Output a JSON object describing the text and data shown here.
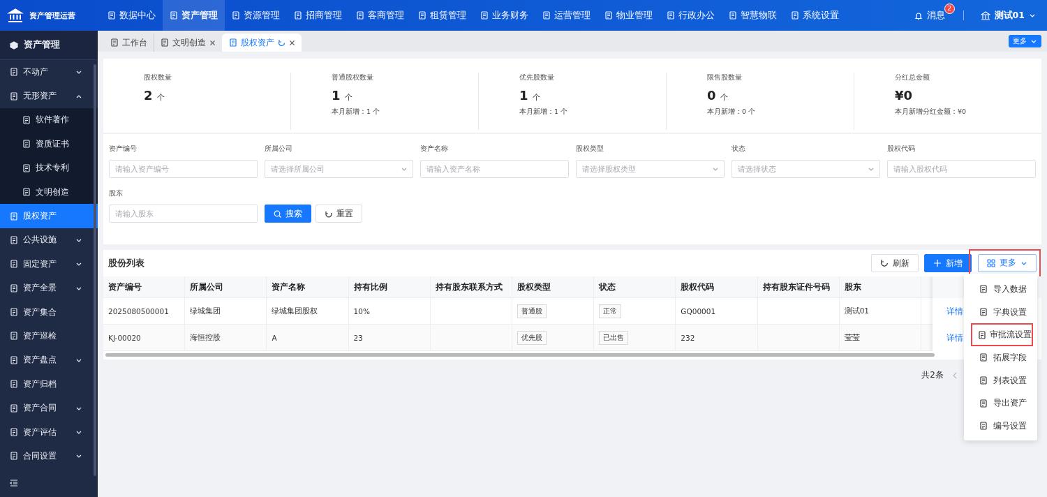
{
  "app": {
    "title": "资产管理运营"
  },
  "top_nav": [
    {
      "label": "数据中心",
      "selected": false
    },
    {
      "label": "资产管理",
      "selected": true
    },
    {
      "label": "资源管理",
      "selected": false
    },
    {
      "label": "招商管理",
      "selected": false
    },
    {
      "label": "客商管理",
      "selected": false
    },
    {
      "label": "租赁管理",
      "selected": false
    },
    {
      "label": "业务财务",
      "selected": false
    },
    {
      "label": "运营管理",
      "selected": false
    },
    {
      "label": "物业管理",
      "selected": false
    },
    {
      "label": "行政办公",
      "selected": false
    },
    {
      "label": "智慧物联",
      "selected": false
    },
    {
      "label": "系统设置",
      "selected": false
    }
  ],
  "top_right": {
    "messages": "消息",
    "badge": "2",
    "user": "测试01"
  },
  "sidebar": {
    "title": "资产管理",
    "items": [
      {
        "label": "不动产",
        "selected": false,
        "expanded": false
      },
      {
        "label": "无形资产",
        "selected": false,
        "expanded": true,
        "children": [
          {
            "label": "软件著作",
            "selected": false
          },
          {
            "label": "资质证书",
            "selected": false
          },
          {
            "label": "技术专利",
            "selected": false
          },
          {
            "label": "文明创造",
            "selected": false
          }
        ]
      },
      {
        "label": "股权资产",
        "selected": true
      },
      {
        "label": "公共设施",
        "selected": false,
        "expanded": false
      },
      {
        "label": "固定资产",
        "selected": false,
        "expanded": false
      },
      {
        "label": "资产全景",
        "selected": false,
        "expanded": false
      },
      {
        "label": "资产集合",
        "selected": false
      },
      {
        "label": "资产巡检",
        "selected": false
      },
      {
        "label": "资产盘点",
        "selected": false,
        "expanded": false
      },
      {
        "label": "资产归档",
        "selected": false
      },
      {
        "label": "资产合同",
        "selected": false,
        "expanded": false
      },
      {
        "label": "资产评估",
        "selected": false,
        "expanded": false
      },
      {
        "label": "合同设置",
        "selected": false,
        "expanded": false
      }
    ]
  },
  "tabs": [
    {
      "label": "工作台",
      "selected": false,
      "closable": false
    },
    {
      "label": "文明创造",
      "selected": false,
      "closable": true
    },
    {
      "label": "股权资产",
      "selected": true,
      "closable": true
    }
  ],
  "tabs_more": "更多",
  "stats": [
    {
      "label": "股权数量",
      "value": "2",
      "unit": "个"
    },
    {
      "label": "普通股权数量",
      "value": "1",
      "unit": "个",
      "sub": "本月新增：1 个"
    },
    {
      "label": "优先股数量",
      "value": "1",
      "unit": "个",
      "sub": "本月新增：1 个"
    },
    {
      "label": "限售股数量",
      "value": "0",
      "unit": "个",
      "sub": "本月新增：0 个"
    },
    {
      "label": "分红总金额",
      "value": "¥0",
      "sub": "本月新增分红金额：¥0"
    }
  ],
  "filters": [
    {
      "label": "资产编号",
      "placeholder": "请输入资产编号",
      "kind": "input"
    },
    {
      "label": "所属公司",
      "placeholder": "请选择所属公司",
      "kind": "select"
    },
    {
      "label": "资产名称",
      "placeholder": "请输入资产名称",
      "kind": "input"
    },
    {
      "label": "股权类型",
      "placeholder": "请选择股权类型",
      "kind": "select"
    },
    {
      "label": "状态",
      "placeholder": "请选择状态",
      "kind": "select"
    },
    {
      "label": "股权代码",
      "placeholder": "请输入股权代码",
      "kind": "input"
    },
    {
      "label": "股东",
      "placeholder": "请输入股东",
      "kind": "input"
    }
  ],
  "filter_buttons": [
    {
      "label": "搜索",
      "kind": "primary"
    },
    {
      "label": "重置",
      "kind": "default"
    }
  ],
  "table": {
    "title": "股份列表",
    "toolbar": [
      {
        "label": "刷新",
        "kind": "refresh",
        "highlighted": false
      },
      {
        "label": "新增",
        "kind": "add",
        "highlighted": false
      },
      {
        "label": "更多",
        "kind": "more",
        "highlighted": true
      }
    ],
    "columns": [
      {
        "label": "资产编号"
      },
      {
        "label": "所属公司"
      },
      {
        "label": "资产名称"
      },
      {
        "label": "持有比例"
      },
      {
        "label": "持有股东联系方式"
      },
      {
        "label": "股权类型",
        "kind": "tag"
      },
      {
        "label": "状态",
        "kind": "tag"
      },
      {
        "label": "股权代码"
      },
      {
        "label": "持有股东证件号码"
      },
      {
        "label": "股东"
      }
    ],
    "rows": [
      {
        "cells": [
          "2025080500001",
          "绿城集团",
          "绿城集团股权",
          "10%",
          "",
          "普通股",
          "正常",
          "GQ00001",
          "",
          "测试01"
        ],
        "action": "详情"
      },
      {
        "cells": [
          "KJ-00020",
          "海恒控股",
          "A",
          "23",
          "",
          "优先股",
          "已出售",
          "232",
          "",
          "莹莹"
        ],
        "action": "详情"
      }
    ]
  },
  "pagination": {
    "total": "共2条"
  },
  "menu": [
    {
      "label": "导入数据",
      "highlighted": false
    },
    {
      "label": "字典设置",
      "highlighted": false
    },
    {
      "label": "审批流设置",
      "highlighted": true
    },
    {
      "label": "拓展字段",
      "highlighted": false
    },
    {
      "label": "列表设置",
      "highlighted": false
    },
    {
      "label": "导出资产",
      "highlighted": false
    },
    {
      "label": "编号设置",
      "highlighted": false
    }
  ]
}
